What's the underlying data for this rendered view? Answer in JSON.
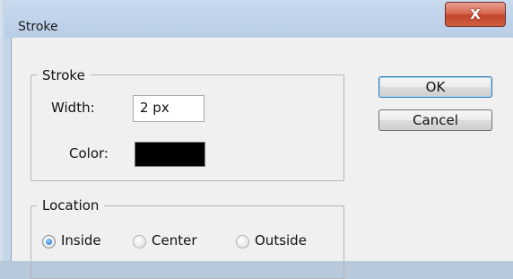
{
  "window": {
    "title": "Stroke",
    "close_glyph": "X"
  },
  "stroke_group": {
    "legend": "Stroke",
    "width_label": "Width:",
    "width_value": "2 px",
    "color_label": "Color:",
    "color_value": "#000000"
  },
  "location_group": {
    "legend": "Location",
    "options": [
      {
        "label": "Inside",
        "selected": true
      },
      {
        "label": "Center",
        "selected": false
      },
      {
        "label": "Outside",
        "selected": false
      }
    ]
  },
  "buttons": {
    "ok_label": "OK",
    "cancel_label": "Cancel"
  }
}
